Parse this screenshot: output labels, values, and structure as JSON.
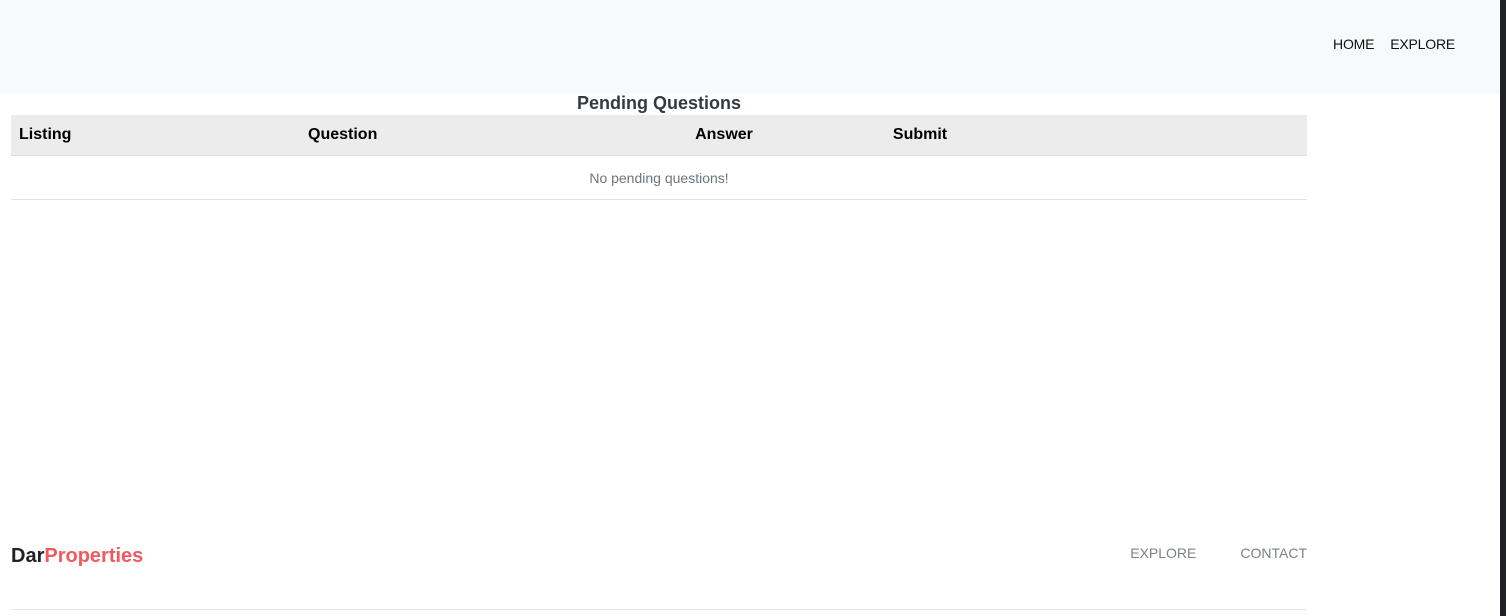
{
  "header": {
    "nav": {
      "home": "HOME",
      "explore": "EXPLORE"
    }
  },
  "main": {
    "title": "Pending Questions",
    "table": {
      "columns": [
        "Listing",
        "Question",
        "Answer",
        "Submit"
      ],
      "empty_message": "No pending questions!"
    }
  },
  "footer": {
    "brand_part1": "Dar",
    "brand_part2": "Properties",
    "nav": {
      "explore": "EXPLORE",
      "contact": "CONTACT"
    }
  },
  "colors": {
    "brand_accent": "#f05a5f",
    "header_bg": "#f8f9fa",
    "table_header_bg": "#ececec"
  }
}
